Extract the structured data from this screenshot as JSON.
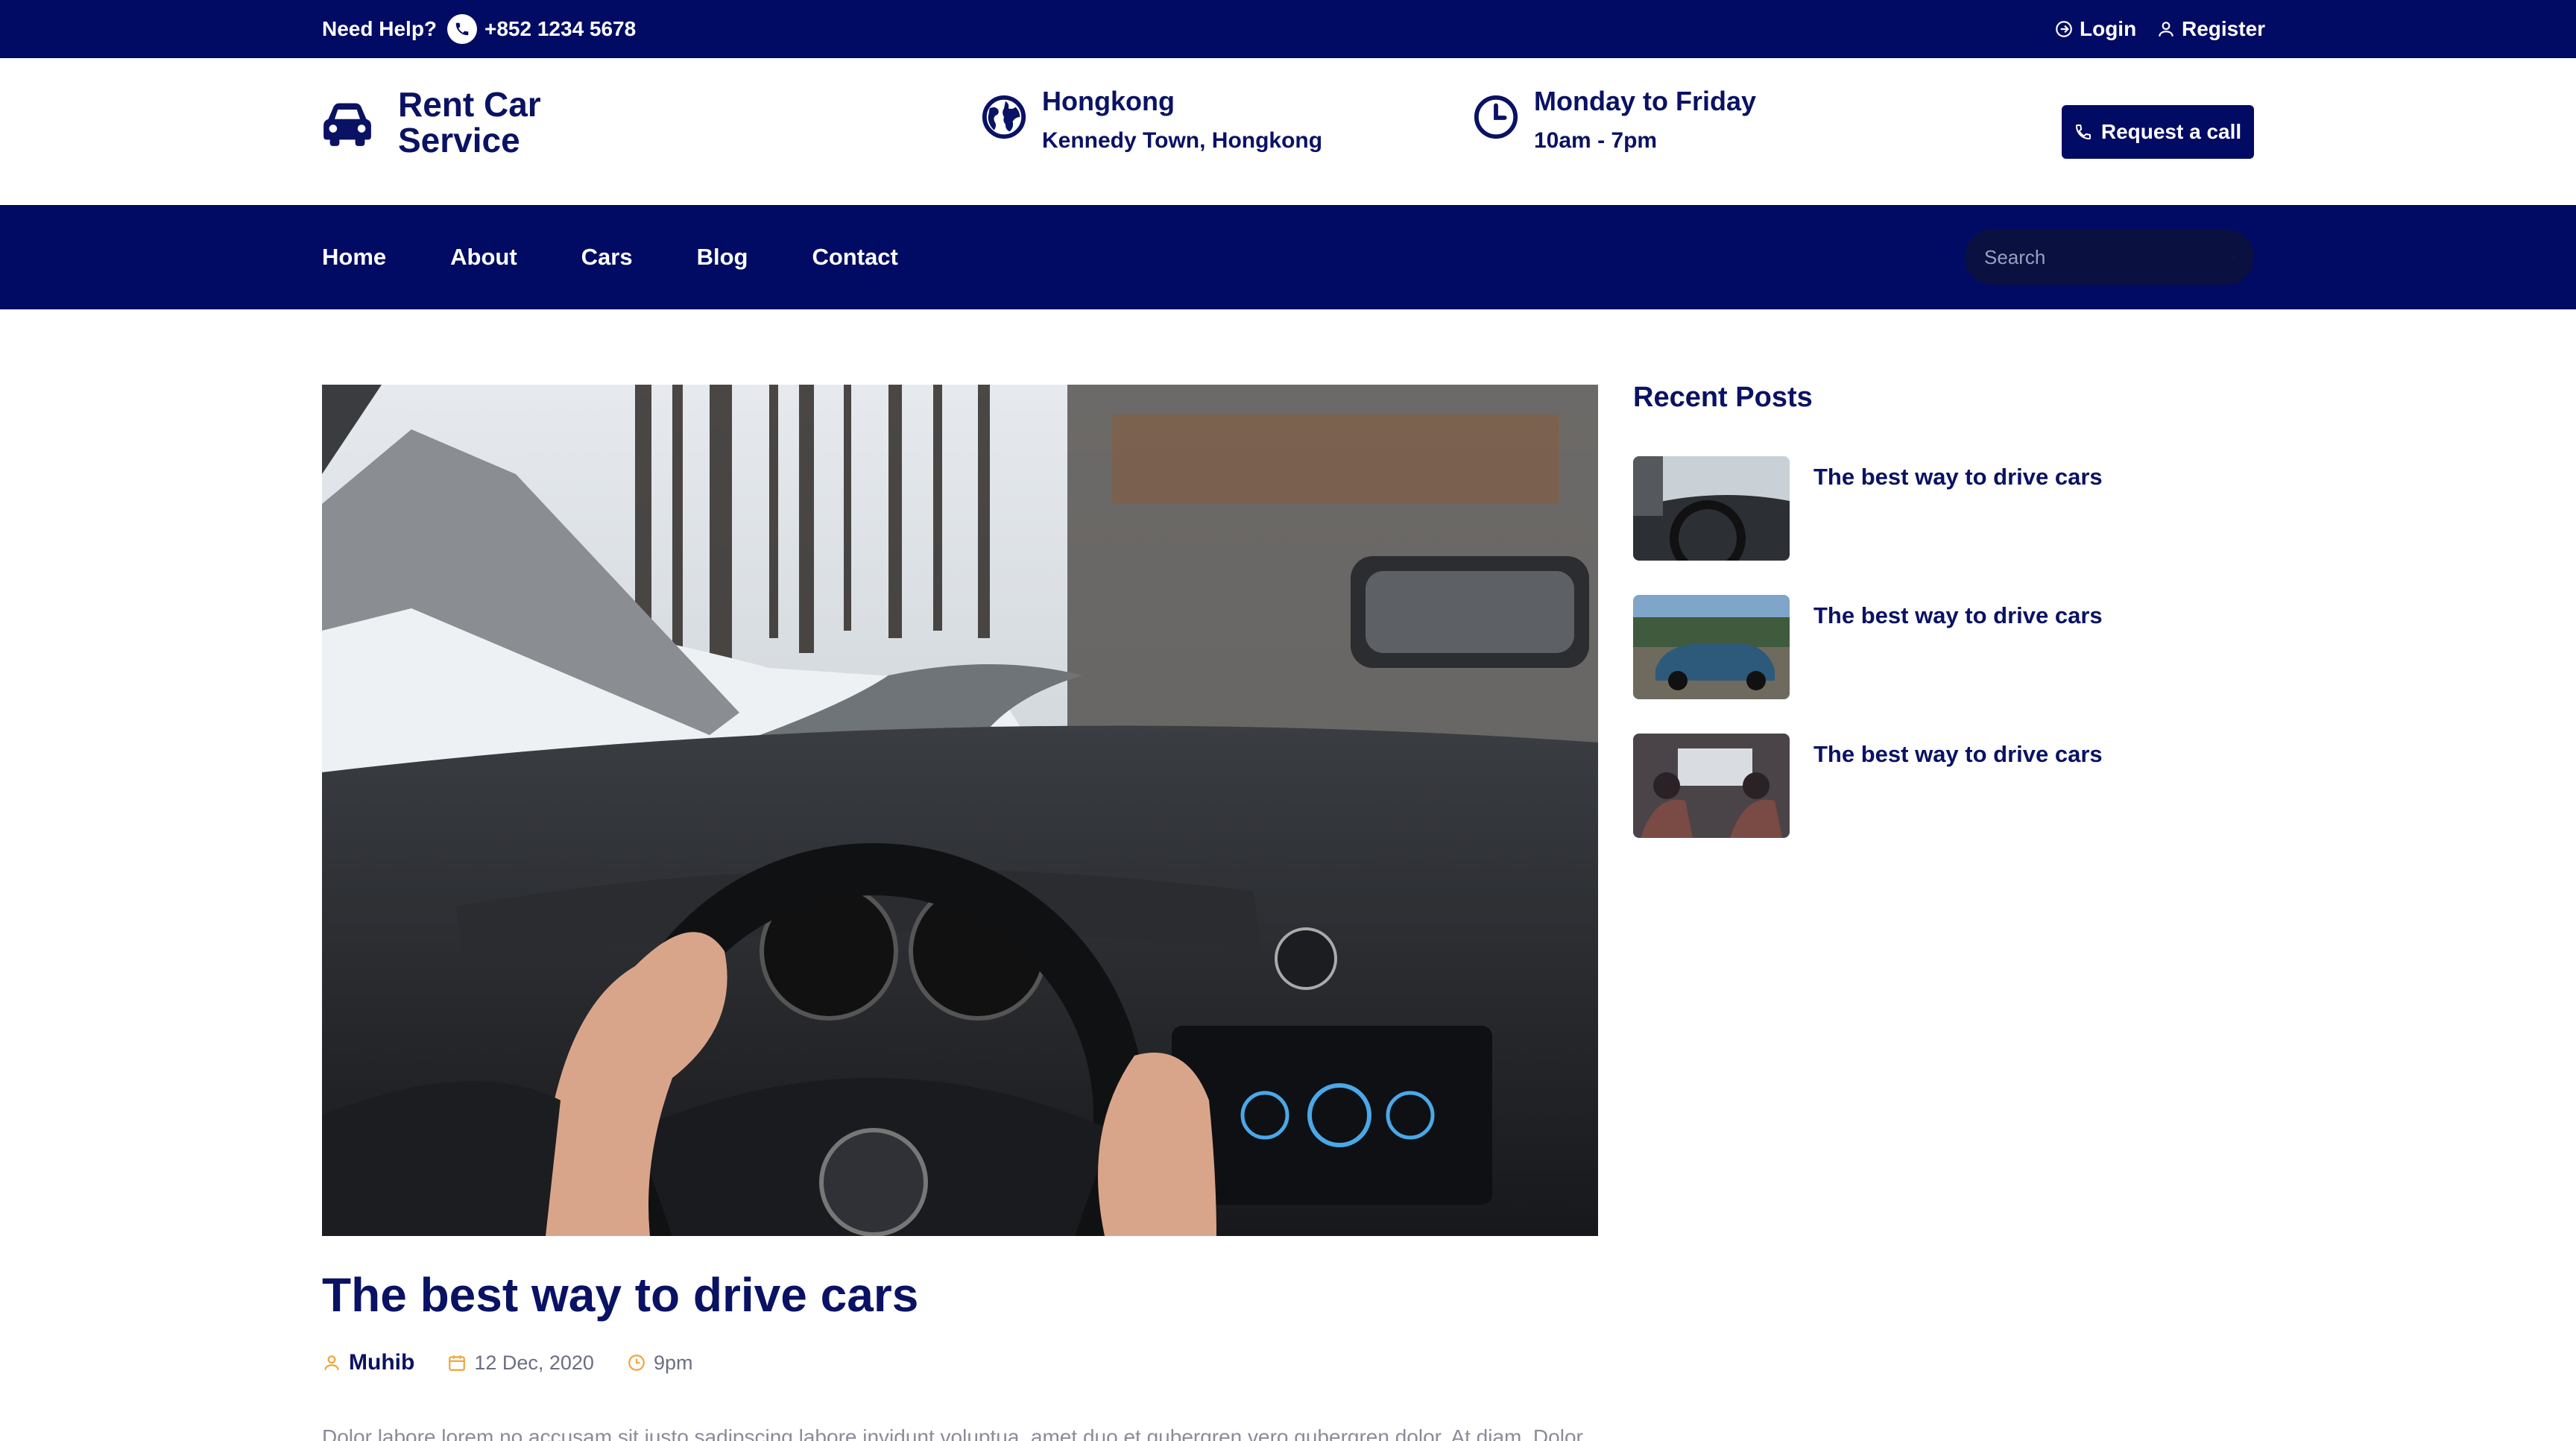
{
  "topbar": {
    "help_label": "Need Help?",
    "phone": "+852 1234 5678",
    "login": "Login",
    "register": "Register"
  },
  "header": {
    "brand_line1": "Rent Car",
    "brand_line2": "Service",
    "location_title": "Hongkong",
    "location_sub": "Kennedy Town, Hongkong",
    "hours_title": "Monday to Friday",
    "hours_sub": "10am - 7pm",
    "request_button": "Request a call"
  },
  "nav": {
    "items": [
      "Home",
      "About",
      "Cars",
      "Blog",
      "Contact"
    ],
    "search_placeholder": "Search"
  },
  "post": {
    "title": "The best way to drive cars",
    "author": "Muhib",
    "date": "12 Dec, 2020",
    "time": "9pm",
    "excerpt": "Dolor labore lorem no accusam sit justo sadipscing labore invidunt voluptua, amet duo et gubergren vero gubergren dolor. At diam. Dolor"
  },
  "sidebar": {
    "title": "Recent Posts",
    "posts": [
      {
        "title": "The best way to drive cars"
      },
      {
        "title": "The best way to drive cars"
      },
      {
        "title": "The best way to drive cars"
      }
    ]
  },
  "colors": {
    "navy": "#020b63",
    "accent_orange": "#f0a33a"
  }
}
